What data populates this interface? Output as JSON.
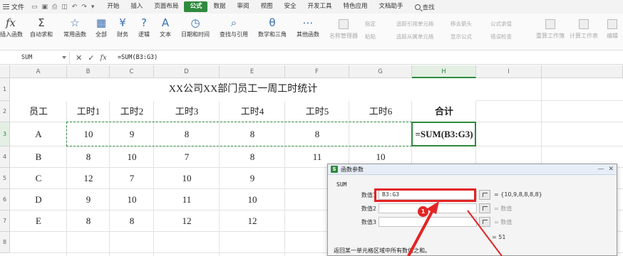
{
  "menubar": {
    "file_label": "文件",
    "tabs": [
      "开始",
      "插入",
      "页面布局",
      "公式",
      "数据",
      "审阅",
      "视图",
      "安全",
      "开发工具",
      "特色应用",
      "文档助手"
    ],
    "active_tab": "公式",
    "search_label": "查找"
  },
  "ribbon": {
    "buttons": [
      {
        "label": "插入函数",
        "icon": "fx-icon",
        "glyph": "fx"
      },
      {
        "label": "自动求和",
        "icon": "sigma-icon",
        "glyph": "Σ"
      },
      {
        "label": "常用函数",
        "icon": "star-icon",
        "glyph": "☆"
      },
      {
        "label": "全部",
        "icon": "all-functions-icon",
        "glyph": "▦"
      },
      {
        "label": "财务",
        "icon": "finance-icon",
        "glyph": "¥"
      },
      {
        "label": "逻辑",
        "icon": "logic-icon",
        "glyph": "?"
      },
      {
        "label": "文本",
        "icon": "text-icon",
        "glyph": "A"
      },
      {
        "label": "日期和时间",
        "icon": "clock-icon",
        "glyph": "◷"
      },
      {
        "label": "查找与引用",
        "icon": "lookup-icon",
        "glyph": "⌕"
      },
      {
        "label": "数学和三角",
        "icon": "math-icon",
        "glyph": "θ"
      },
      {
        "label": "其他函数",
        "icon": "more-functions-icon",
        "glyph": "⋯"
      }
    ],
    "gray_big": [
      "名称管理器"
    ],
    "gray_small": [
      "指定",
      "粘贴",
      "追踪引用单元格",
      "追踪从属单元格",
      "移去箭头",
      "显示公式",
      "公式求值",
      "错误检查"
    ],
    "gray_right": [
      "重算工作簿",
      "计算工作表",
      "编辑"
    ]
  },
  "formula_bar": {
    "name_box": "SUM",
    "cancel_glyph": "✕",
    "confirm_glyph": "✓",
    "fx_glyph": "fx",
    "content": "=SUM(B3:G3)"
  },
  "sheet": {
    "columns": [
      "A",
      "B",
      "C",
      "D",
      "E",
      "F",
      "G",
      "H",
      "I"
    ],
    "rows": [
      "1",
      "2",
      "3",
      "4",
      "5",
      "6",
      "7",
      "8"
    ],
    "title": "XX公司XX部门员工一周工时统计",
    "headers": [
      "员工",
      "工时1",
      "工时2",
      "工时3",
      "工时4",
      "工时5",
      "工时6",
      "合计"
    ],
    "data": [
      {
        "name": "A",
        "values": [
          "10",
          "9",
          "8",
          "8",
          "8",
          ""
        ],
        "total": "=SUM(B3:G3)"
      },
      {
        "name": "B",
        "values": [
          "8",
          "10",
          "7",
          "8",
          "11",
          "10"
        ],
        "total": ""
      },
      {
        "name": "C",
        "values": [
          "12",
          "7",
          "10",
          "9",
          "",
          ""
        ],
        "total": ""
      },
      {
        "name": "D",
        "values": [
          "9",
          "10",
          "11",
          "10",
          "",
          ""
        ],
        "total": ""
      },
      {
        "name": "E",
        "values": [
          "8",
          "8",
          "12",
          "12",
          "",
          ""
        ],
        "total": ""
      }
    ]
  },
  "dialog": {
    "title": "函数参数",
    "function_name": "SUM",
    "args": [
      {
        "label": "数值1",
        "value": "B3:G3",
        "result": "= {10,9,8,8,8,8}"
      },
      {
        "label": "数值2",
        "value": "",
        "result": "= 数值"
      },
      {
        "label": "数值3",
        "value": "",
        "result": "= 数值"
      }
    ],
    "result": "= 51",
    "description": "返回某一单元格区域中所有数值之和。",
    "minimize_glyph": "—",
    "close_glyph": "✕"
  },
  "annotation": {
    "badge": "1",
    "color": "#e32424"
  },
  "colors": {
    "accent": "#2f8a3e",
    "annotation": "#e32424"
  }
}
